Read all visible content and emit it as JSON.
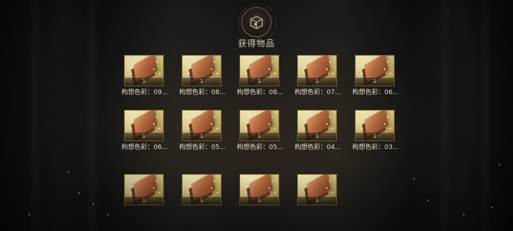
{
  "header": {
    "title": "获得物品",
    "icon": "chest-icon"
  },
  "items": [
    {
      "name": "构想色彩：09...",
      "count": "1"
    },
    {
      "name": "构想色彩：08...",
      "count": "1"
    },
    {
      "name": "构想色彩：08...",
      "count": "1"
    },
    {
      "name": "构想色彩：07...",
      "count": "1"
    },
    {
      "name": "构想色彩：06...",
      "count": "1"
    },
    {
      "name": "构想色彩：06...",
      "count": "1"
    },
    {
      "name": "构想色彩：05...",
      "count": "1"
    },
    {
      "name": "构想色彩：05...",
      "count": "1"
    },
    {
      "name": "构想色彩：04...",
      "count": "1"
    },
    {
      "name": "构想色彩：03...",
      "count": "1"
    },
    {
      "name": "",
      "count": "1"
    },
    {
      "name": "",
      "count": "1"
    },
    {
      "name": "",
      "count": "1"
    },
    {
      "name": "",
      "count": "1"
    }
  ],
  "colors": {
    "title": "#d9cbb3",
    "tile_gold": "#cdb974",
    "block_copper": "#b1673d"
  }
}
